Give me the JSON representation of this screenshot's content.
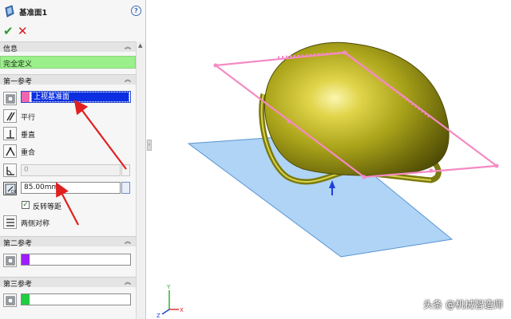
{
  "panel": {
    "title": "基准面1",
    "sections": {
      "info": "信息",
      "status": "完全定义",
      "first_ref": "第一参考",
      "second_ref": "第二参考",
      "third_ref": "第三参考"
    },
    "first": {
      "selection": "上视基准面",
      "options": {
        "parallel": "平行",
        "perpendicular": "垂直",
        "coincident": "重合"
      },
      "angle_value": "0",
      "offset_value": "85.00mm",
      "reverse_label": "反转等距",
      "reverse_checked": true,
      "symmetric_label": "两侧对称",
      "chip_color": "#ee66b0"
    },
    "second": {
      "chip_color": "#9b1fff"
    },
    "third": {
      "chip_color": "#20cc40"
    }
  },
  "graphics": {
    "watermark": "头条 @机械智造师"
  },
  "colors": {
    "ok_green": "#2e9a2e",
    "cancel_red": "#d21d1d",
    "status_green": "#9af08a",
    "selection_blue": "#0a2ee0",
    "plane_blue": "#a9d1f5",
    "plane_pink": "#f48ac4",
    "helmet_olive": "#a7a21a",
    "arrow_red": "#e02020"
  },
  "icons": [
    "feature-plane-icon",
    "help-icon",
    "ok-check-icon",
    "cancel-x-icon",
    "chevron-up-icon",
    "parallel-icon",
    "perpendicular-icon",
    "coincident-icon",
    "angle-icon",
    "offset-distance-icon",
    "symmetric-icon",
    "plane-select-icon",
    "triad-icon"
  ]
}
